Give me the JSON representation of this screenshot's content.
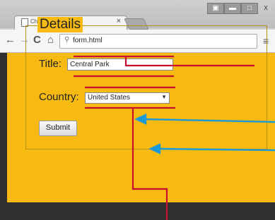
{
  "browser": {
    "tab_title": "Chapter 5",
    "tab_close": "×",
    "url": "form.html",
    "window_buttons": {
      "restore": "▣",
      "minimize": "▬",
      "maximize": "□",
      "close": "x"
    },
    "nav": {
      "back": "←",
      "forward": "→",
      "reload": "C",
      "home": "⌂",
      "menu": "≡"
    },
    "icons": {
      "search": "search-icon",
      "page": "document-icon"
    }
  },
  "form": {
    "legend": "Details",
    "title_label": "Title:",
    "title_value": "Central Park",
    "country_label": "Country:",
    "country_value": "United States",
    "submit_label": "Submit"
  },
  "colors": {
    "page_background": "#f6ba12",
    "annotation_red": "#c8102e",
    "annotation_blue": "#1a9ad6"
  }
}
